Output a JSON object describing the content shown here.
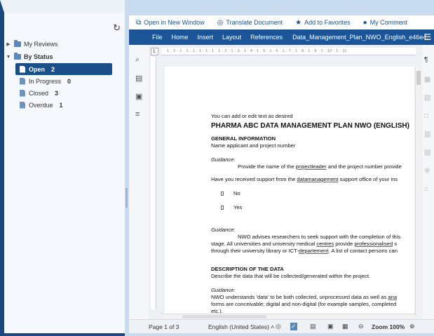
{
  "sidebar": {
    "refresh_icon": "refresh-icon",
    "items": [
      {
        "label": "My Reviews",
        "expanded": false
      },
      {
        "label": "By Status",
        "expanded": true
      }
    ],
    "status_items": [
      {
        "label": "Open",
        "count": "2",
        "selected": true
      },
      {
        "label": "In Progress",
        "count": "0",
        "selected": false
      },
      {
        "label": "Closed",
        "count": "3",
        "selected": false
      },
      {
        "label": "Overdue",
        "count": "1",
        "selected": false
      }
    ]
  },
  "toolbar": {
    "open_new_window": "Open in New Window",
    "translate": "Translate Document",
    "add_favorites": "Add to Favorites",
    "my_comment": "My Comment"
  },
  "menu": {
    "file": "File",
    "home": "Home",
    "insert": "Insert",
    "layout": "Layout",
    "references": "References",
    "doc_title": "Data_Management_Plan_NWO_English_e46e4..."
  },
  "ruler": {
    "corner": "L",
    "ticks": "1 · 2 · 1 · 1 · 1 · 1 · 1 · 1 · 1 · 2 · 1 · 3 · 1 · 4 · 1 · 5 · 1 · 6 · 1 · 7 · 1 · 8 · 1 · 9 · 1 · 10 · 1 · 11"
  },
  "document": {
    "line1": "You can add or edit text as desired",
    "title": "PHARMA ABC DATA MANAGEMENT PLAN NWO (ENGLISH)",
    "section1": "GENERAL INFORMATION",
    "section1_text": "Name applicant and project number",
    "guidance": "Guidance:",
    "guidance1_pre": "Provide the name of the ",
    "guidance1_link": "projectleader",
    "guidance1_post": " and the project number provide",
    "question_pre": "Have you received support from the ",
    "question_link": "datamanagement",
    "question_post": " support office of your ins",
    "option_no": "No",
    "option_yes": "Yes",
    "guidance2_line1": "NWO advises researchers to seek support with the completion of this",
    "guidance2_line2_pre": "stage. All universities and university medical ",
    "guidance2_line2_link1": "centres",
    "guidance2_line2_mid": " provide ",
    "guidance2_line2_link2": "professionalised",
    "guidance2_line2_post": " s",
    "guidance2_line3_pre": "through their university library or ICT-",
    "guidance2_line3_link": "departement",
    "guidance2_line3_post": ". A list of contact persons can",
    "section2": "DESCRIPTION OF THE DATA",
    "section2_text": "Describe the data that will be collected/generated within the project.",
    "guidance3_line1_pre": "NWO understands 'data' to be both collected, unprocessed data as well as ",
    "guidance3_line1_link": "ana",
    "guidance3_line2": "forms are conceivable; digital and non-digital (for example samples, completed",
    "guidance3_line3": "etc.)."
  },
  "status_bar": {
    "page": "Page 1 of 3",
    "language": "English (United States)",
    "zoom": "Zoom 100%"
  },
  "colors": {
    "menu_bar": "#1c5597",
    "selected": "#1b4f8a",
    "accent": "#1d4f86"
  }
}
